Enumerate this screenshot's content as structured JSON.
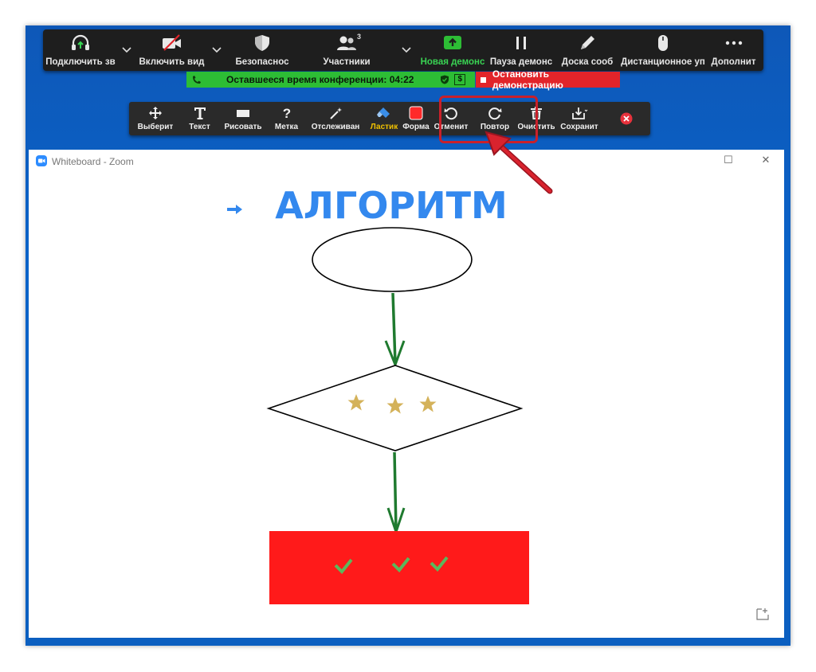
{
  "meeting_bar": {
    "items": [
      {
        "label": "Подключить зв",
        "icon": "headphones-arrow-icon"
      },
      {
        "label": "Включить вид",
        "icon": "camera-off-icon"
      },
      {
        "label": "Безопаснос",
        "icon": "shield-icon"
      },
      {
        "label": "Участники",
        "icon": "participants-icon",
        "count": "3"
      },
      {
        "label": "Новая демонс",
        "icon": "share-screen-icon"
      },
      {
        "label": "Пауза демонс",
        "icon": "pause-icon"
      },
      {
        "label": "Доска сооб",
        "icon": "pencil-icon"
      },
      {
        "label": "Дистанционное уп",
        "icon": "mouse-icon"
      },
      {
        "label": "Дополнит",
        "icon": "more-dots-icon"
      }
    ]
  },
  "timer": {
    "text": "Оставшееся время конференции: 04:22",
    "badge": "$"
  },
  "stop_share": {
    "label": "Остановить демонстрацию"
  },
  "annotation_bar": {
    "items": [
      {
        "label": "Выберит",
        "icon": "move-arrows-icon"
      },
      {
        "label": "Текст",
        "icon": "text-t-icon"
      },
      {
        "label": "Рисовать",
        "icon": "draw-rectangle-icon"
      },
      {
        "label": "Метка",
        "icon": "question-mark-icon"
      },
      {
        "label": "Отслеживан",
        "icon": "magic-wand-icon"
      },
      {
        "label": "Ластик",
        "icon": "eraser-icon"
      },
      {
        "label": "Форма",
        "icon": "color-format-icon"
      },
      {
        "label": "Отменит",
        "icon": "undo-icon"
      },
      {
        "label": "Повтор",
        "icon": "redo-icon"
      },
      {
        "label": "Очистить",
        "icon": "trash-icon"
      },
      {
        "label": "Сохранит",
        "icon": "save-download-icon"
      }
    ],
    "close_icon": "close-circle-icon"
  },
  "whiteboard_window": {
    "title": "Whiteboard - Zoom",
    "minimize": "—",
    "maximize": "☐",
    "close": "✕"
  },
  "canvas": {
    "heading": "АЛГОРИТМ"
  },
  "colors": {
    "accent_green": "#2dbd35",
    "stop_red": "#e2242a",
    "heading_blue": "#3388ee",
    "arrow_green": "#1f7a2f",
    "box_red": "#ff1a1a",
    "star_gold": "#d4b25a",
    "highlight_red": "#c9202a"
  }
}
